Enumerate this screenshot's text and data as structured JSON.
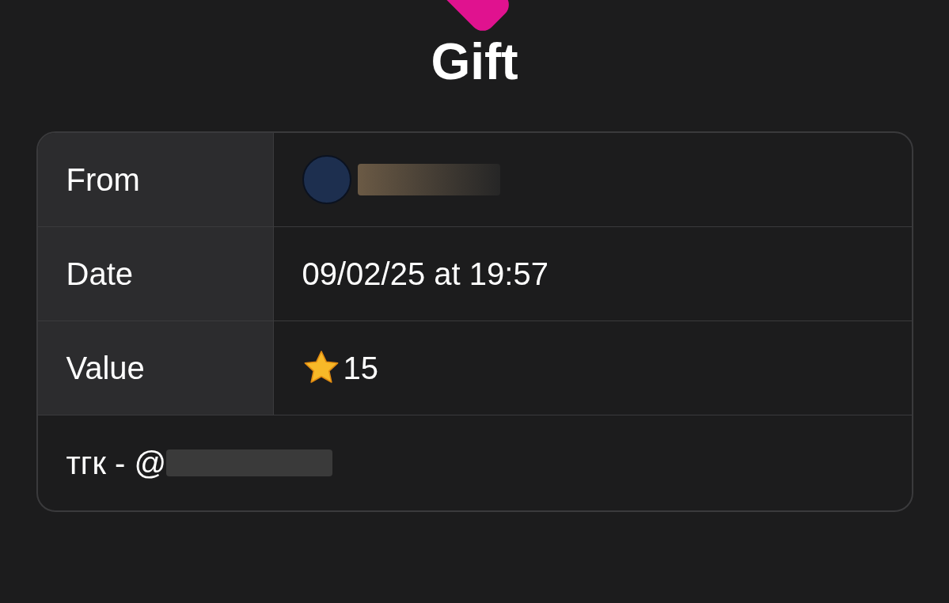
{
  "title": "Gift",
  "rows": [
    {
      "kind": "sender",
      "label": "From"
    },
    {
      "kind": "text",
      "label": "Date",
      "value": "09/02/25 at 19:57"
    },
    {
      "kind": "stars",
      "label": "Value",
      "value": "15"
    }
  ],
  "comment": "тгк - @"
}
